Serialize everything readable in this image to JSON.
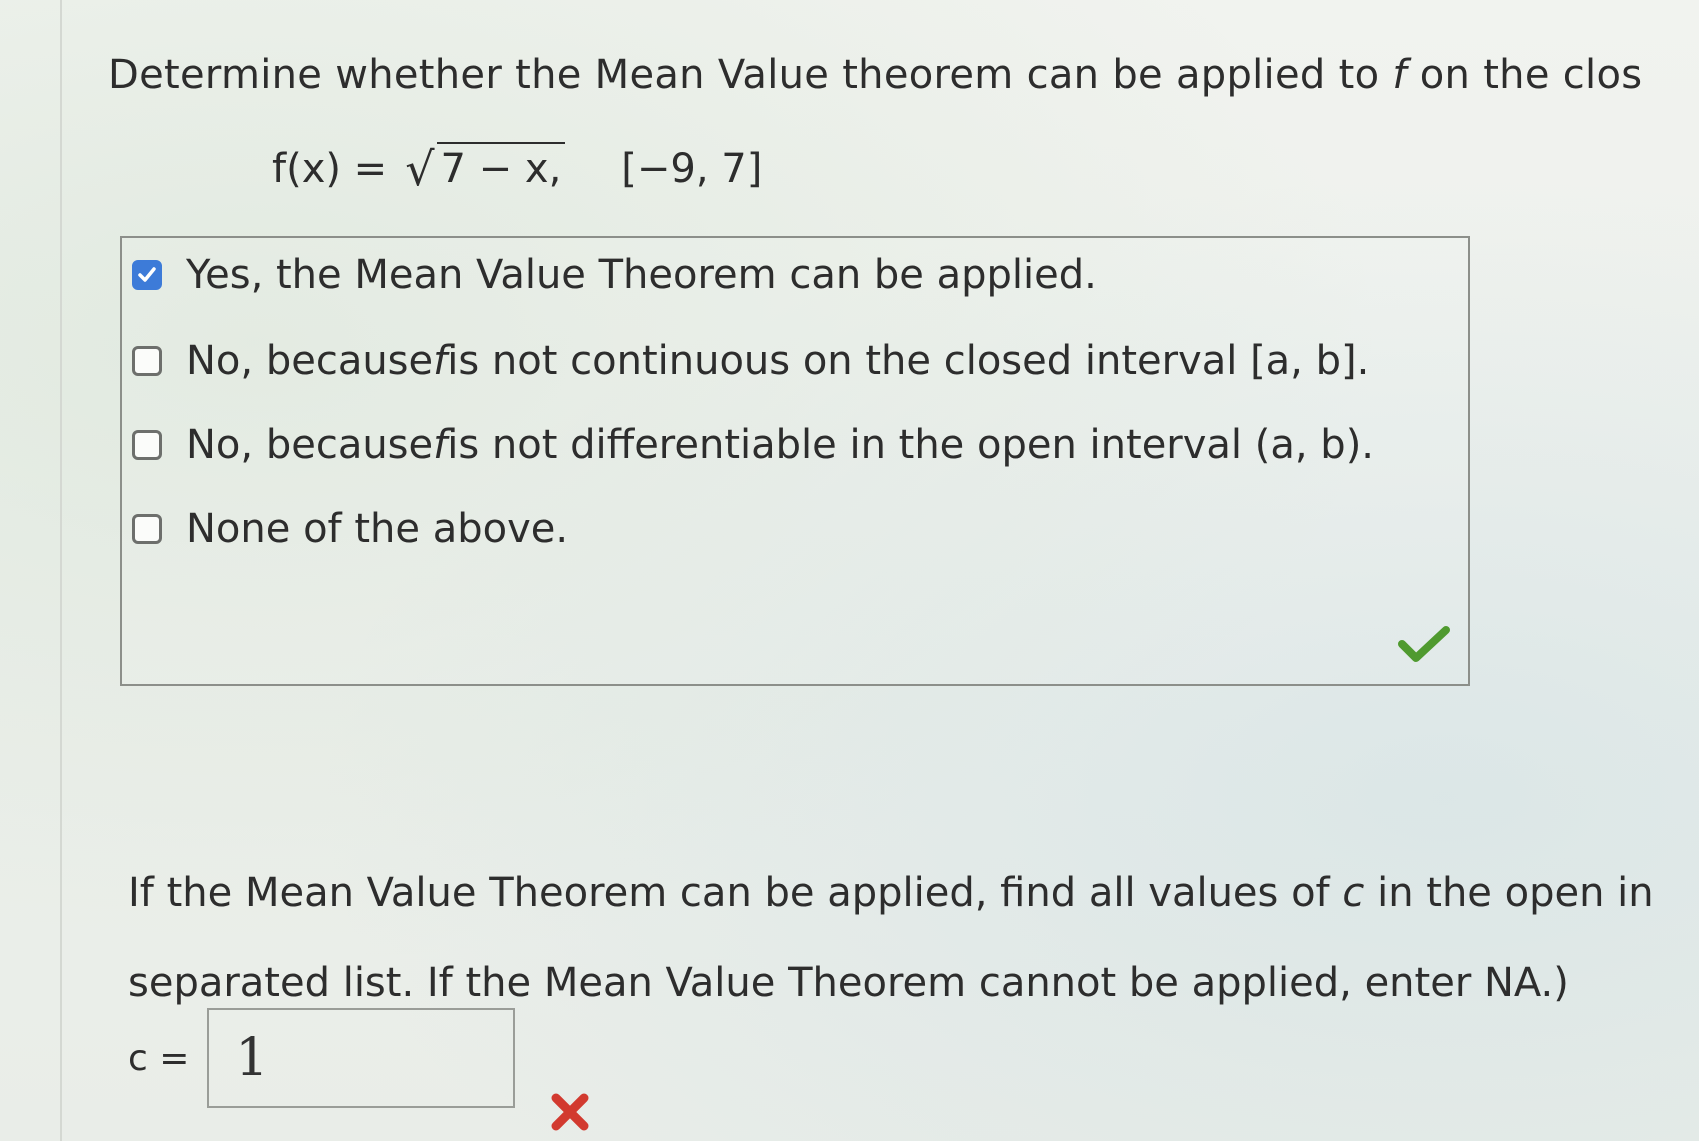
{
  "question": {
    "title_part1": "Determine whether the Mean Value theorem can be applied to ",
    "title_var": "f",
    "title_part2": " on the clos",
    "formula": {
      "lhs": "f(x) =",
      "radicand": "7 − x,",
      "interval": "[−9, 7]"
    }
  },
  "options": [
    {
      "checked": true,
      "text_before": "Yes, the Mean Value Theorem can be applied.",
      "var": "",
      "text_after": ""
    },
    {
      "checked": false,
      "text_before": "No, because ",
      "var": "f",
      "text_after": " is not continuous on the closed interval [a, b]."
    },
    {
      "checked": false,
      "text_before": "No, because ",
      "var": "f",
      "text_after": " is not differentiable in the open interval (a, b)."
    },
    {
      "checked": false,
      "text_before": "None of the above.",
      "var": "",
      "text_after": ""
    }
  ],
  "part2": {
    "line1_before": "If the Mean Value Theorem can be applied, find all values of ",
    "line1_var": "c",
    "line1_after": " in the open in",
    "line2": "separated list. If the Mean Value Theorem cannot be applied, enter NA.)",
    "c_label": "c =",
    "answer_value": "1"
  },
  "status_icons": {
    "part1": "correct-check-icon",
    "part2": "incorrect-x-icon"
  },
  "colors": {
    "checkbox_checked": "#3d7bd8",
    "correct": "#4f9a2f",
    "incorrect": "#d23a2f"
  }
}
